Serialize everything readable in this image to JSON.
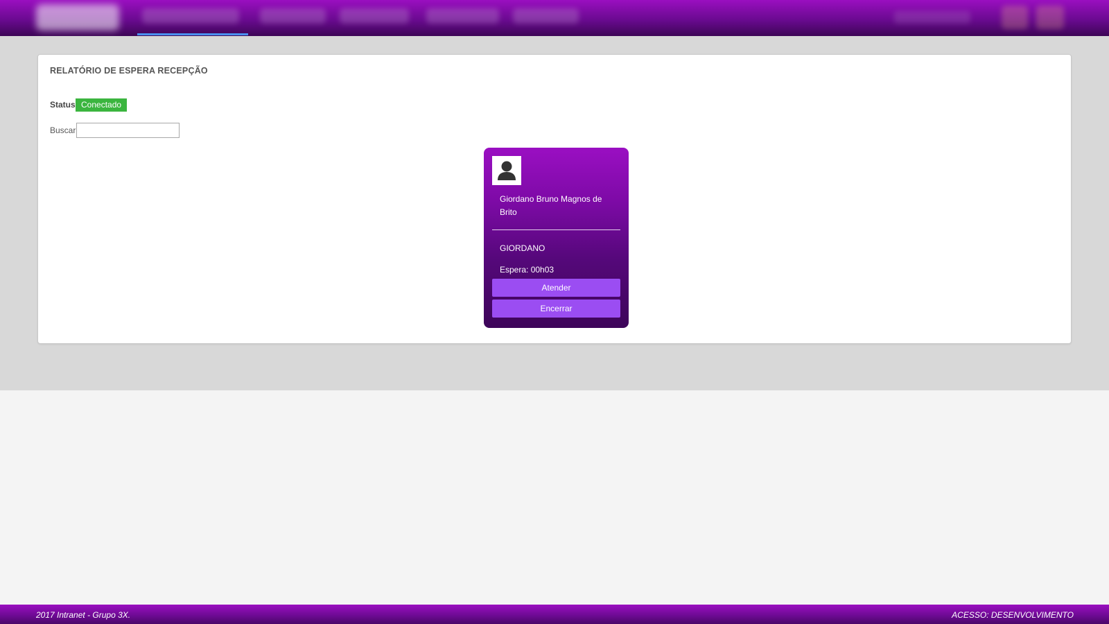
{
  "header": {
    "nav_items": [
      "",
      "",
      "",
      "",
      ""
    ],
    "active_indicator_color": "#4a8ff0"
  },
  "panel": {
    "title": "RELATÓRIO DE ESPERA RECEPÇÃO",
    "status_label": "Status:",
    "status_value": "Conectado",
    "status_color": "#3bb53f",
    "search_label": "Buscar",
    "search_value": ""
  },
  "card": {
    "avatar_icon": "user-silhouette-icon",
    "patient_name": "Giordano Bruno Magnos de Brito",
    "username": "GIORDANO",
    "wait_text": "Espera: 00h03",
    "attend_label": "Atender",
    "close_label": "Encerrar",
    "button_color": "#9b4df2"
  },
  "footer": {
    "left_text": "2017 Intranet - Grupo 3X.",
    "right_text": "ACESSO: DESENVOLVIMENTO"
  }
}
